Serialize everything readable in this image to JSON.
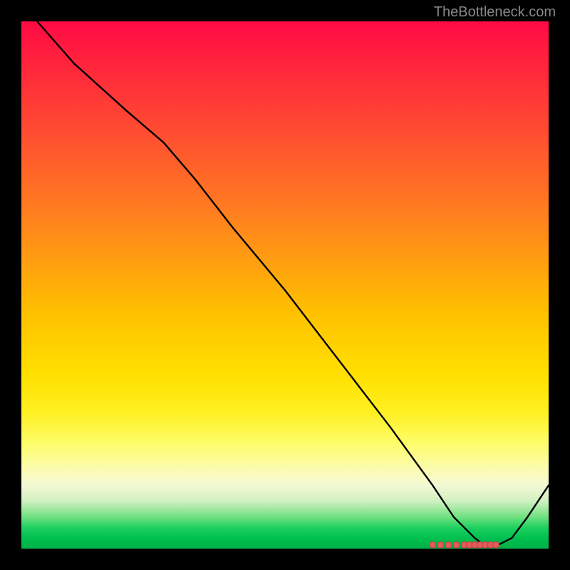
{
  "watermark": "TheBottleneck.com",
  "chart_data": {
    "type": "line",
    "title": "",
    "xlabel": "",
    "ylabel": "",
    "xlim": [
      0,
      100
    ],
    "ylim": [
      0,
      100
    ],
    "series": [
      {
        "name": "curve",
        "x": [
          3,
          10,
          20,
          27,
          33,
          40,
          50,
          60,
          70,
          78,
          82,
          86,
          88,
          90,
          93,
          96,
          100
        ],
        "y": [
          100,
          92,
          83,
          77,
          70,
          61,
          49,
          36,
          23,
          12,
          6,
          2,
          0.5,
          0.5,
          2,
          6,
          12
        ]
      }
    ],
    "optimal_markers": {
      "y": 0.7,
      "x": [
        78,
        79.5,
        81,
        82.5,
        84,
        85,
        86,
        87,
        88,
        89,
        90
      ]
    }
  },
  "colors": {
    "gradient_top": "#ff0a45",
    "gradient_mid": "#ffe000",
    "gradient_bottom": "#00b048",
    "curve": "#000000",
    "dots": "#e25a5a"
  }
}
